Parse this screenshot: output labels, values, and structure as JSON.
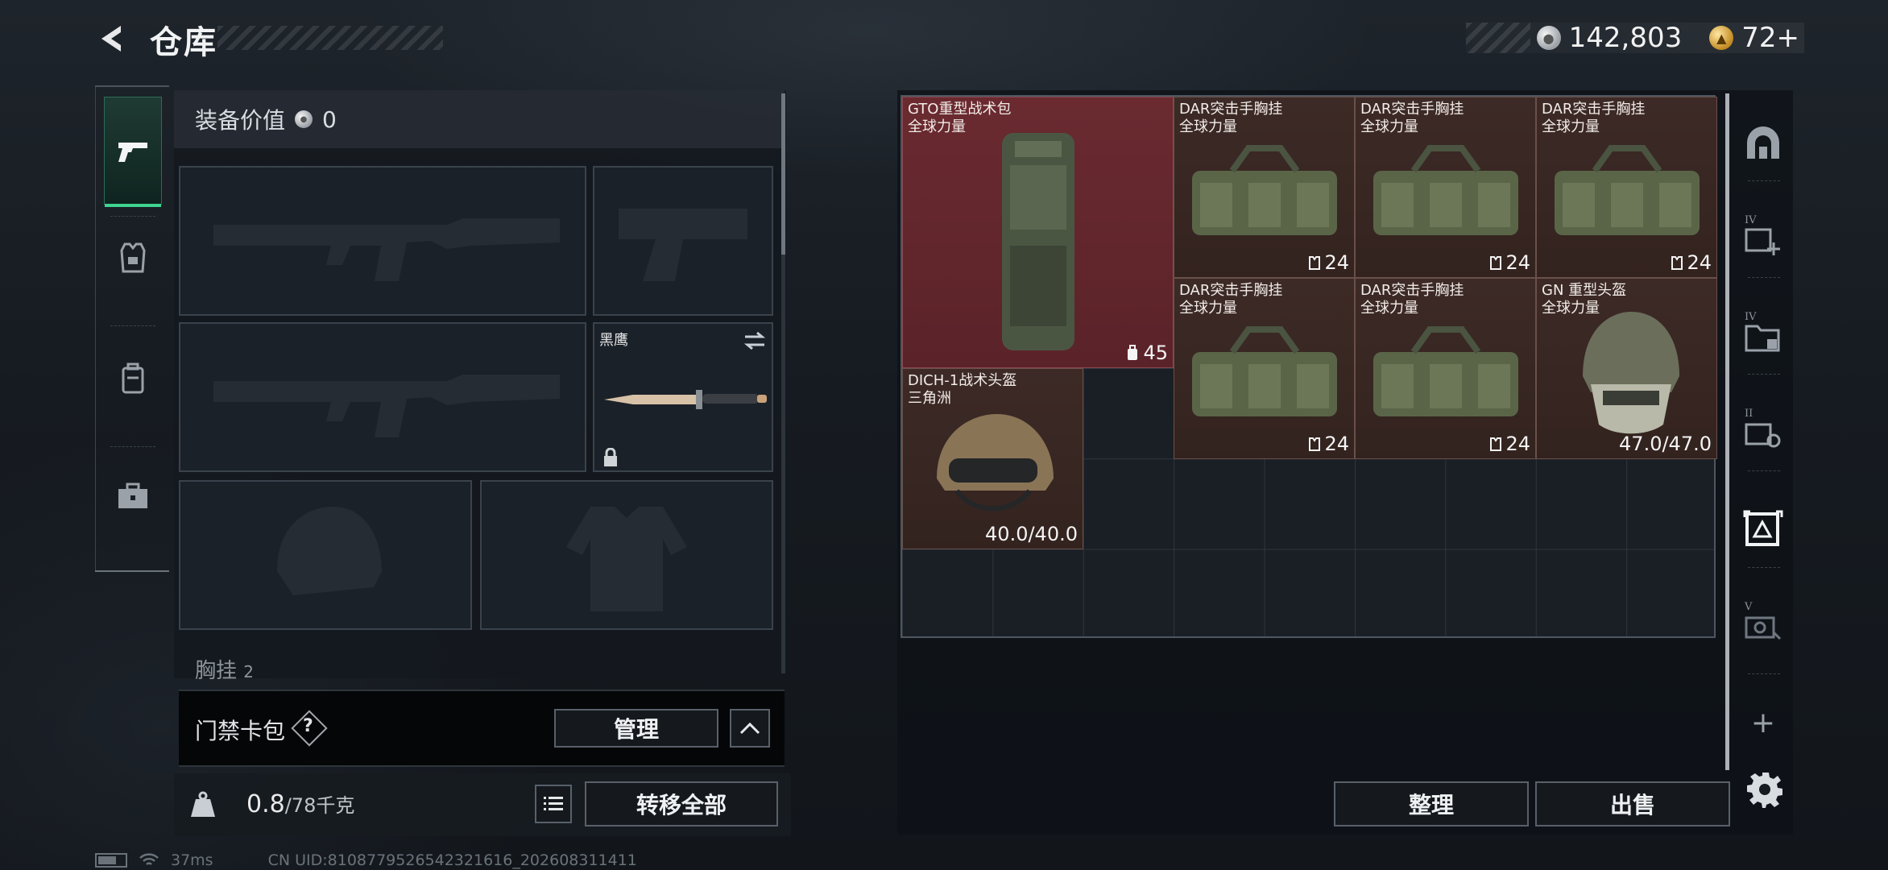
{
  "header": {
    "title": "仓库",
    "currency": [
      {
        "icon": "silver-coin-icon",
        "value": "142,803"
      },
      {
        "icon": "gold-triangle-icon",
        "value": "72+"
      }
    ]
  },
  "tabs": [
    {
      "name": "weapon",
      "icon": "pistol-icon",
      "active": true
    },
    {
      "name": "armor",
      "icon": "vest-icon",
      "active": false
    },
    {
      "name": "backpack",
      "icon": "backpack-icon",
      "active": false
    },
    {
      "name": "supplies",
      "icon": "briefcase-icon",
      "active": false
    }
  ],
  "loadout": {
    "equip_value_label": "装备价值",
    "equip_value": "0",
    "melee_name": "黑鹰",
    "chest_label": "胸挂",
    "chest_count": "2"
  },
  "card_wallet": {
    "label": "门禁卡包",
    "help": "?",
    "manage_label": "管理"
  },
  "weight": {
    "current": "0.8",
    "max": "/78千克",
    "kg_icon": "KG"
  },
  "transfer_all_label": "转移全部",
  "storage_items": [
    {
      "line1": "GTO重型战术包",
      "line2": "全球力量",
      "count": "45",
      "count_icon": "bag"
    },
    {
      "line1": "DAR突击手胸挂",
      "line2": "全球力量",
      "count": "24",
      "count_icon": "vest"
    },
    {
      "line1": "DAR突击手胸挂",
      "line2": "全球力量",
      "count": "24",
      "count_icon": "vest"
    },
    {
      "line1": "DAR突击手胸挂",
      "line2": "全球力量",
      "count": "24",
      "count_icon": "vest"
    },
    {
      "line1": "DAR突击手胸挂",
      "line2": "全球力量",
      "count": "24",
      "count_icon": "vest"
    },
    {
      "line1": "DAR突击手胸挂",
      "line2": "全球力量",
      "count": "24",
      "count_icon": "vest"
    },
    {
      "line1": "GN 重型头盔",
      "line2": "全球力量",
      "count": "47.0/47.0",
      "count_icon": ""
    },
    {
      "line1": "DICH-1战术头盔",
      "line2": "三角洲",
      "count": "40.0/40.0",
      "count_icon": ""
    }
  ],
  "side_tabs": [
    {
      "icon": "base-icon",
      "roman": ""
    },
    {
      "icon": "add-storage-icon",
      "roman": "IV"
    },
    {
      "icon": "folder-storage-icon",
      "roman": "IV"
    },
    {
      "icon": "gear-storage-icon",
      "roman": "II"
    },
    {
      "icon": "triangle-storage-icon",
      "roman": ""
    },
    {
      "icon": "camera-storage-icon",
      "roman": "V"
    }
  ],
  "side_add": "+",
  "buttons": {
    "sort": "整理",
    "sell": "出售"
  },
  "status_bar": {
    "ping": "37ms",
    "uid": "CN UID:8108779526542321616_202608311411"
  }
}
